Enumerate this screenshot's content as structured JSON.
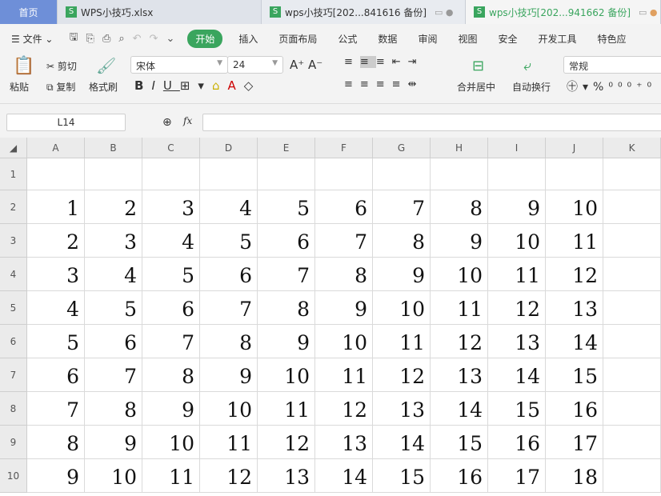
{
  "tabs": {
    "home": "首页",
    "tab1": "WPS小技巧.xlsx",
    "tab2": "wps小技巧[202...841616 备份]",
    "tab3": "wps小技巧[202...941662 备份]",
    "sheet_icon": "S"
  },
  "menu": {
    "file": "文件",
    "items": [
      "开始",
      "插入",
      "页面布局",
      "公式",
      "数据",
      "审阅",
      "视图",
      "安全",
      "开发工具",
      "特色应"
    ]
  },
  "ribbon": {
    "paste": "粘贴",
    "cut": "剪切",
    "copy": "复制",
    "format_painter": "格式刷",
    "font": "宋体",
    "font_size": "24",
    "merge": "合并居中",
    "wrap": "自动换行",
    "number_format": "常规"
  },
  "formula_bar": {
    "cell_ref": "L14",
    "fx": "fx",
    "value": ""
  },
  "sheet": {
    "columns": [
      "A",
      "B",
      "C",
      "D",
      "E",
      "F",
      "G",
      "H",
      "I",
      "J",
      "K"
    ],
    "rows": [
      "1",
      "2",
      "3",
      "4",
      "5",
      "6",
      "7",
      "8",
      "9",
      "10"
    ],
    "values": [
      [],
      [
        1,
        2,
        3,
        4,
        5,
        6,
        7,
        8,
        9,
        10
      ],
      [
        2,
        3,
        4,
        5,
        6,
        7,
        8,
        9,
        10,
        11
      ],
      [
        3,
        4,
        5,
        6,
        7,
        8,
        9,
        10,
        11,
        12
      ],
      [
        4,
        5,
        6,
        7,
        8,
        9,
        10,
        11,
        12,
        13
      ],
      [
        5,
        6,
        7,
        8,
        9,
        10,
        11,
        12,
        13,
        14
      ],
      [
        6,
        7,
        8,
        9,
        10,
        11,
        12,
        13,
        14,
        15
      ],
      [
        7,
        8,
        9,
        10,
        11,
        12,
        13,
        14,
        15,
        16
      ],
      [
        8,
        9,
        10,
        11,
        12,
        13,
        14,
        15,
        16,
        17
      ],
      [
        9,
        10,
        11,
        12,
        13,
        14,
        15,
        16,
        17,
        18
      ]
    ]
  }
}
